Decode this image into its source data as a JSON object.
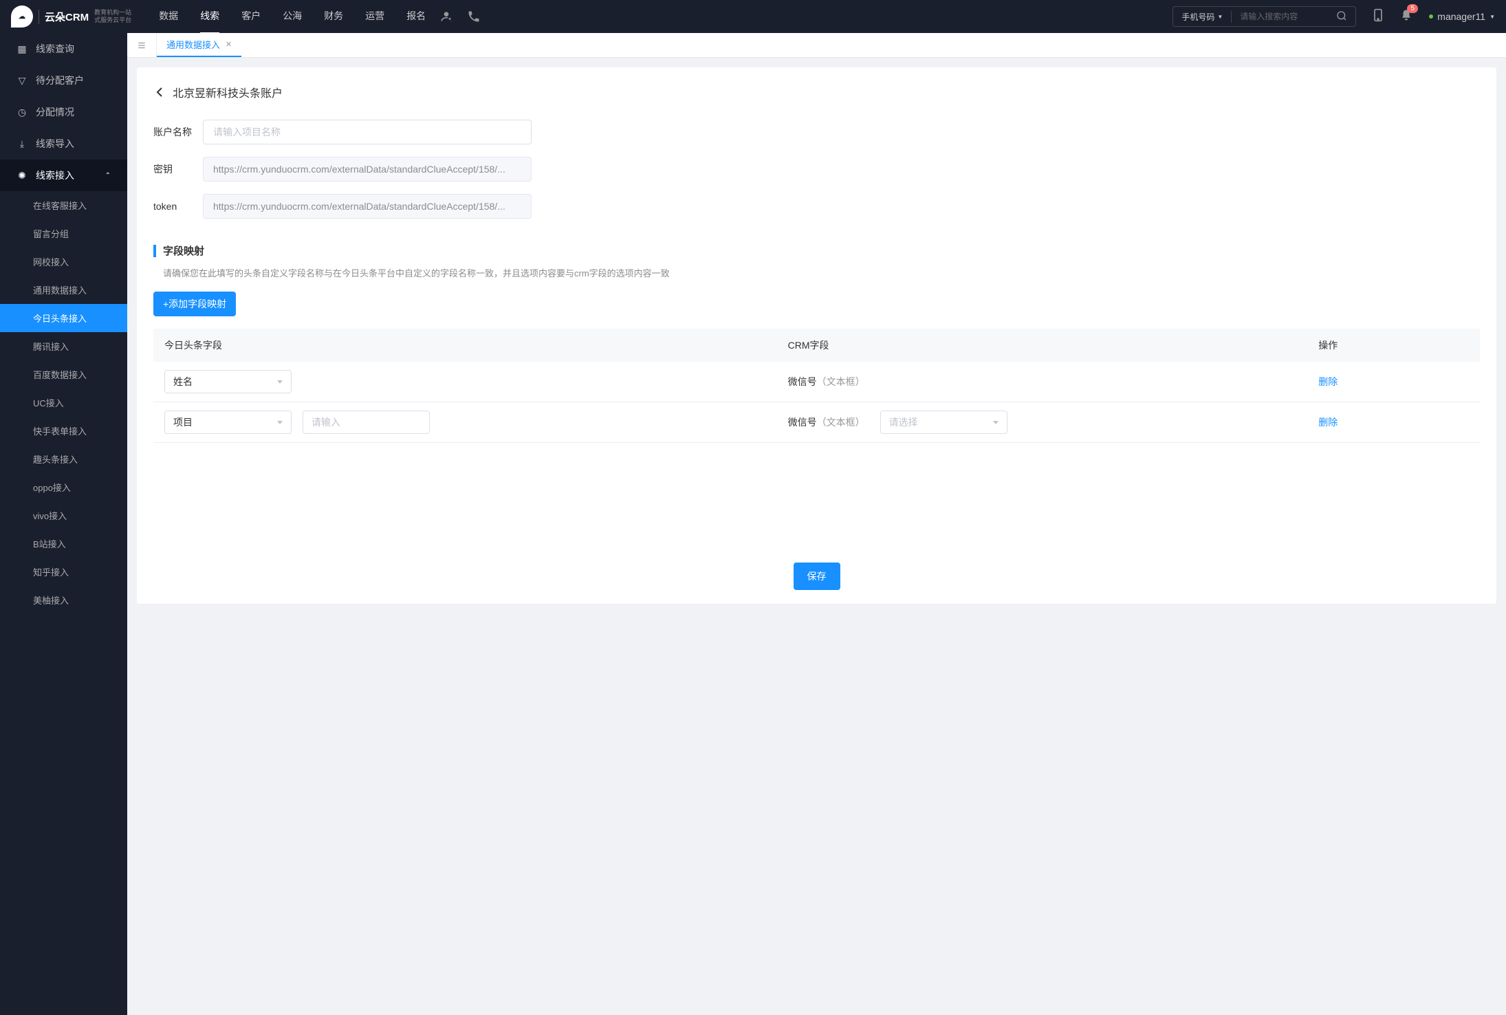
{
  "header": {
    "logo_brand": "云朵CRM",
    "logo_sub_line1": "教育机构一站",
    "logo_sub_line2": "式服务云平台",
    "nav": [
      "数据",
      "线索",
      "客户",
      "公海",
      "财务",
      "运营",
      "报名"
    ],
    "nav_active_index": 1,
    "search_type": "手机号码",
    "search_placeholder": "请输入搜索内容",
    "notification_badge": "5",
    "username": "manager11"
  },
  "sidebar": {
    "items": [
      {
        "icon": "▦",
        "label": "线索查询"
      },
      {
        "icon": "▽",
        "label": "待分配客户"
      },
      {
        "icon": "◷",
        "label": "分配情况"
      },
      {
        "icon": "⤓",
        "label": "线索导入"
      },
      {
        "icon": "✺",
        "label": "线索接入",
        "expanded": true
      }
    ],
    "sub_items": [
      "在线客服接入",
      "留言分组",
      "网校接入",
      "通用数据接入",
      "今日头条接入",
      "腾讯接入",
      "百度数据接入",
      "UC接入",
      "快手表单接入",
      "趣头条接入",
      "oppo接入",
      "vivo接入",
      "B站接入",
      "知乎接入",
      "美柚接入"
    ],
    "sub_active_index": 4
  },
  "tabs": {
    "active_tab": "通用数据接入"
  },
  "page": {
    "breadcrumb_title": "北京昱新科技头条账户",
    "form": {
      "account_name_label": "账户名称",
      "account_name_placeholder": "请输入项目名称",
      "secret_label": "密钥",
      "secret_value": "https://crm.yunduocrm.com/externalData/standardClueAccept/158/...",
      "token_label": "token",
      "token_value": "https://crm.yunduocrm.com/externalData/standardClueAccept/158/..."
    },
    "mapping_section": {
      "title": "字段映射",
      "hint": "请确保您在此填写的头条自定义字段名称与在今日头条平台中自定义的字段名称一致，并且选项内容要与crm字段的选项内容一致",
      "add_button": "+添加字段映射",
      "headers": {
        "toutiao_field": "今日头条字段",
        "crm_field": "CRM字段",
        "action": "操作"
      },
      "rows": [
        {
          "toutiao_value": "姓名",
          "input_value": "",
          "input_placeholder": "",
          "has_input": false,
          "crm_label": "微信号",
          "crm_type": "（文本框）",
          "has_crm_select": false,
          "action": "删除"
        },
        {
          "toutiao_value": "项目",
          "input_value": "",
          "input_placeholder": "请输入",
          "has_input": true,
          "crm_label": "微信号",
          "crm_type": "（文本框）",
          "has_crm_select": true,
          "crm_select_placeholder": "请选择",
          "action": "删除"
        }
      ]
    },
    "save_button": "保存"
  }
}
